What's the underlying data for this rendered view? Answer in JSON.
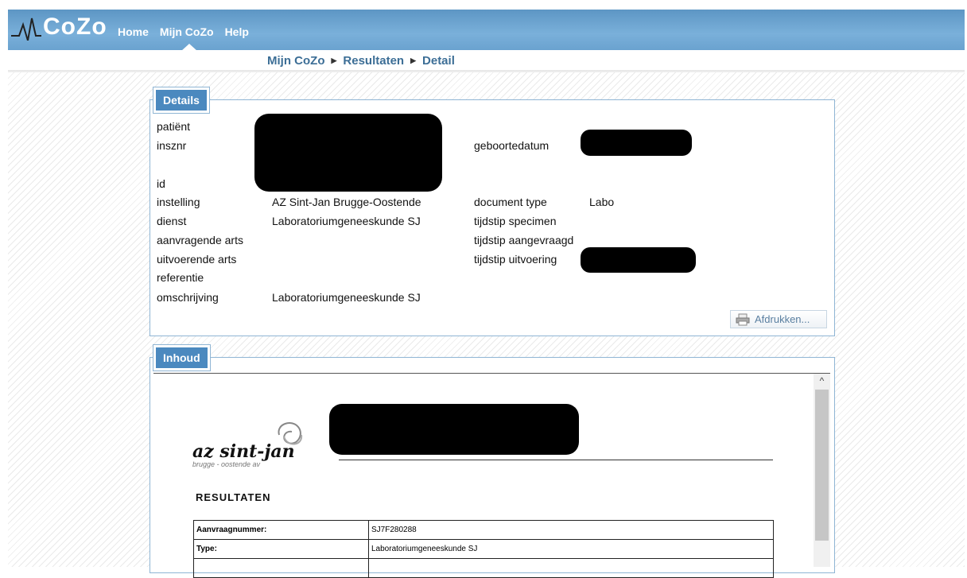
{
  "app": {
    "logo_text": "CoZo",
    "nav": [
      "Home",
      "Mijn CoZo",
      "Help"
    ]
  },
  "breadcrumb": [
    "Mijn CoZo",
    "Resultaten",
    "Detail"
  ],
  "details": {
    "legend": "Details",
    "labels": {
      "patient": "patiënt",
      "insznr": "insznr",
      "id": "id",
      "instelling": "instelling",
      "dienst": "dienst",
      "aanvragende_arts": "aanvragende arts",
      "uitvoerende_arts": "uitvoerende arts",
      "referentie": "referentie",
      "omschrijving": "omschrijving",
      "geboortedatum": "geboortedatum",
      "document_type": "document type",
      "tijdstip_specimen": "tijdstip specimen",
      "tijdstip_aangevraagd": "tijdstip aangevraagd",
      "tijdstip_uitvoering": "tijdstip uitvoering"
    },
    "values": {
      "instelling": "AZ Sint-Jan Brugge-Oostende",
      "dienst": "Laboratoriumgeneeskunde SJ",
      "omschrijving": "Laboratoriumgeneeskunde SJ",
      "document_type": "Labo"
    },
    "print_label": "Afdrukken..."
  },
  "content": {
    "legend": "Inhoud",
    "hospital_name": "az sint-jan",
    "hospital_sub": "brugge - oostende av",
    "results_title": "RESULTATEN",
    "rows": [
      {
        "key": "Aanvraagnummer:",
        "value": "SJ7F280288"
      },
      {
        "key": "Type:",
        "value": "Laboratoriumgeneeskunde SJ"
      },
      {
        "key": "",
        "value": ""
      }
    ]
  },
  "colors": {
    "header": "#6aa2cf",
    "legend": "#4b89bf",
    "breadcrumb": "#3c6e96"
  }
}
